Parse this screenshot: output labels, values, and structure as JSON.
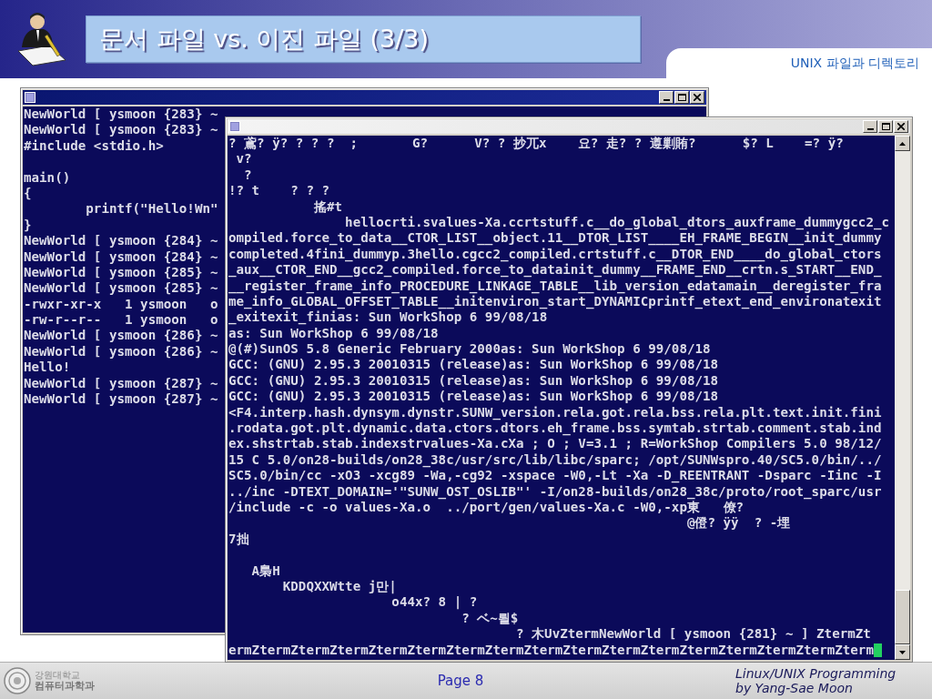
{
  "slide": {
    "title": "문서 파일 vs. 이진 파일 (3/3)",
    "section": "UNIX 파일과 디렉토리"
  },
  "windows": [
    {
      "active": true,
      "blocks": [
        [
          "NewWorld [ ysmoon {283} ~",
          "NewWorld [ ysmoon {283} ~",
          "#include <stdio.h>"
        ],
        [
          "main()",
          "{",
          "        printf(\"Hello!Wn\"",
          "}",
          "NewWorld [ ysmoon {284} ~",
          "NewWorld [ ysmoon {284} ~",
          "NewWorld [ ysmoon {285} ~",
          "NewWorld [ ysmoon {285} ~",
          "-rwxr-xr-x   1 ysmoon   o",
          "-rw-r--r--   1 ysmoon   o",
          "NewWorld [ ysmoon {286} ~",
          "NewWorld [ ysmoon {286} ~",
          "Hello!",
          "NewWorld [ ysmoon {287} ~",
          "NewWorld [ ysmoon {287} ~"
        ]
      ]
    },
    {
      "active": false,
      "cursor": true,
      "blocks": [
        [
          "? 鳶? ÿ? ? ? ?  ;       G?      V? ? 抄兀x    요? 走? ? 遵剿賄?      $? L    =? ÿ?",
          " v?",
          "  ?",
          "!? t    ? ? ?",
          "           搖#t",
          "               hellocrti.svalues-Xa.ccrtstuff.c__do_global_dtors_auxframe_dummygcc2_c",
          "ompiled.force_to_data__CTOR_LIST__object.11__DTOR_LIST____EH_FRAME_BEGIN__init_dummy",
          "completed.4fini_dummyp.3hello.cgcc2_compiled.crtstuff.c__DTOR_END____do_global_ctors",
          "_aux__CTOR_END__gcc2_compiled.force_to_datainit_dummy__FRAME_END__crtn.s_START__END_",
          "__register_frame_info_PROCEDURE_LINKAGE_TABLE__lib_version_edatamain__deregister_fra",
          "me_info_GLOBAL_OFFSET_TABLE__initenviron_start_DYNAMICprintf_etext_end_environatexit",
          "_exitexit_finias: Sun WorkShop 6 99/08/18",
          "as: Sun WorkShop 6 99/08/18",
          "@(#)SunOS 5.8 Generic February 2000as: Sun WorkShop 6 99/08/18",
          "GCC: (GNU) 2.95.3 20010315 (release)as: Sun WorkShop 6 99/08/18",
          "GCC: (GNU) 2.95.3 20010315 (release)as: Sun WorkShop 6 99/08/18",
          "GCC: (GNU) 2.95.3 20010315 (release)as: Sun WorkShop 6 99/08/18",
          "<F4.interp.hash.dynsym.dynstr.SUNW_version.rela.got.rela.bss.rela.plt.text.init.fini",
          ".rodata.got.plt.dynamic.data.ctors.dtors.eh_frame.bss.symtab.strtab.comment.stab.ind",
          "ex.shstrtab.stab.indexstrvalues-Xa.cXa ; O ; V=3.1 ; R=WorkShop Compilers 5.0 98/12/",
          "15 C 5.0/on28-builds/on28_38c/usr/src/lib/libc/sparc; /opt/SUNWspro.40/SC5.0/bin/../",
          "SC5.0/bin/cc -xO3 -xcg89 -Wa,-cg92 -xspace -W0,-Lt -Xa -D_REENTRANT -Dsparc -Iinc -I",
          "../inc -DTEXT_DOMAIN='\"SUNW_OST_OSLIB\"' -I/on28-builds/on28_38c/proto/root_sparc/usr",
          "/include -c -o values-Xa.o  ../port/gen/values-Xa.c -W0,-xp東   僚?",
          "                                                           @僜? ÿÿ  ? -埋",
          "7拙"
        ],
        [
          "   A梟H",
          "       KDDQXXWtte j만|",
          "                     o44x? 8 | ?",
          "                              ? ベ~뢸$",
          "                                     ? 木UvZtermNewWorld [ ysmoon {281} ~ ] ZtermZt",
          "ermZtermZtermZtermZtermZtermZtermZtermZtermZtermZtermZtermZtermZtermZtermZtermZterm"
        ]
      ]
    }
  ],
  "footer": {
    "school": "강원대학교",
    "department": "컴퓨터과학과",
    "page": "Page 8",
    "credit": [
      "Linux/UNIX Programming",
      "by Yang-Sae Moon"
    ]
  }
}
